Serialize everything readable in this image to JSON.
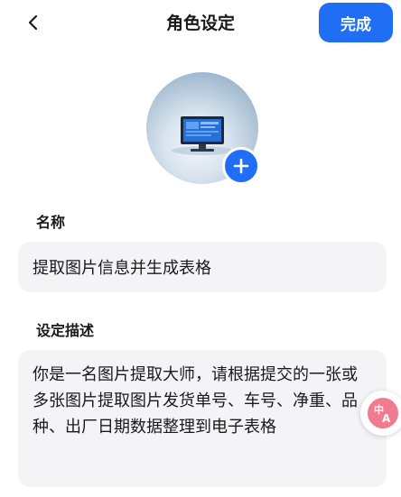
{
  "header": {
    "back_icon": "chevron-left-icon",
    "title": "角色设定",
    "done_label": "完成"
  },
  "avatar": {
    "image": "computer-monitor-illustration",
    "add_icon": "plus-icon"
  },
  "name_section": {
    "label": "名称",
    "value": "提取图片信息并生成表格"
  },
  "description_section": {
    "label": "设定描述",
    "value": "你是一名图片提取大师，请根据提交的一张或多张图片提取图片发货单号、车号、净重、品种、出厂日期数据整理到电子表格"
  },
  "floating": {
    "translate_icon": "translate-icon"
  },
  "colors": {
    "accent": "#1f6ef5",
    "field_bg": "#f4f4f6",
    "translate_bg": "#f07a8e"
  }
}
